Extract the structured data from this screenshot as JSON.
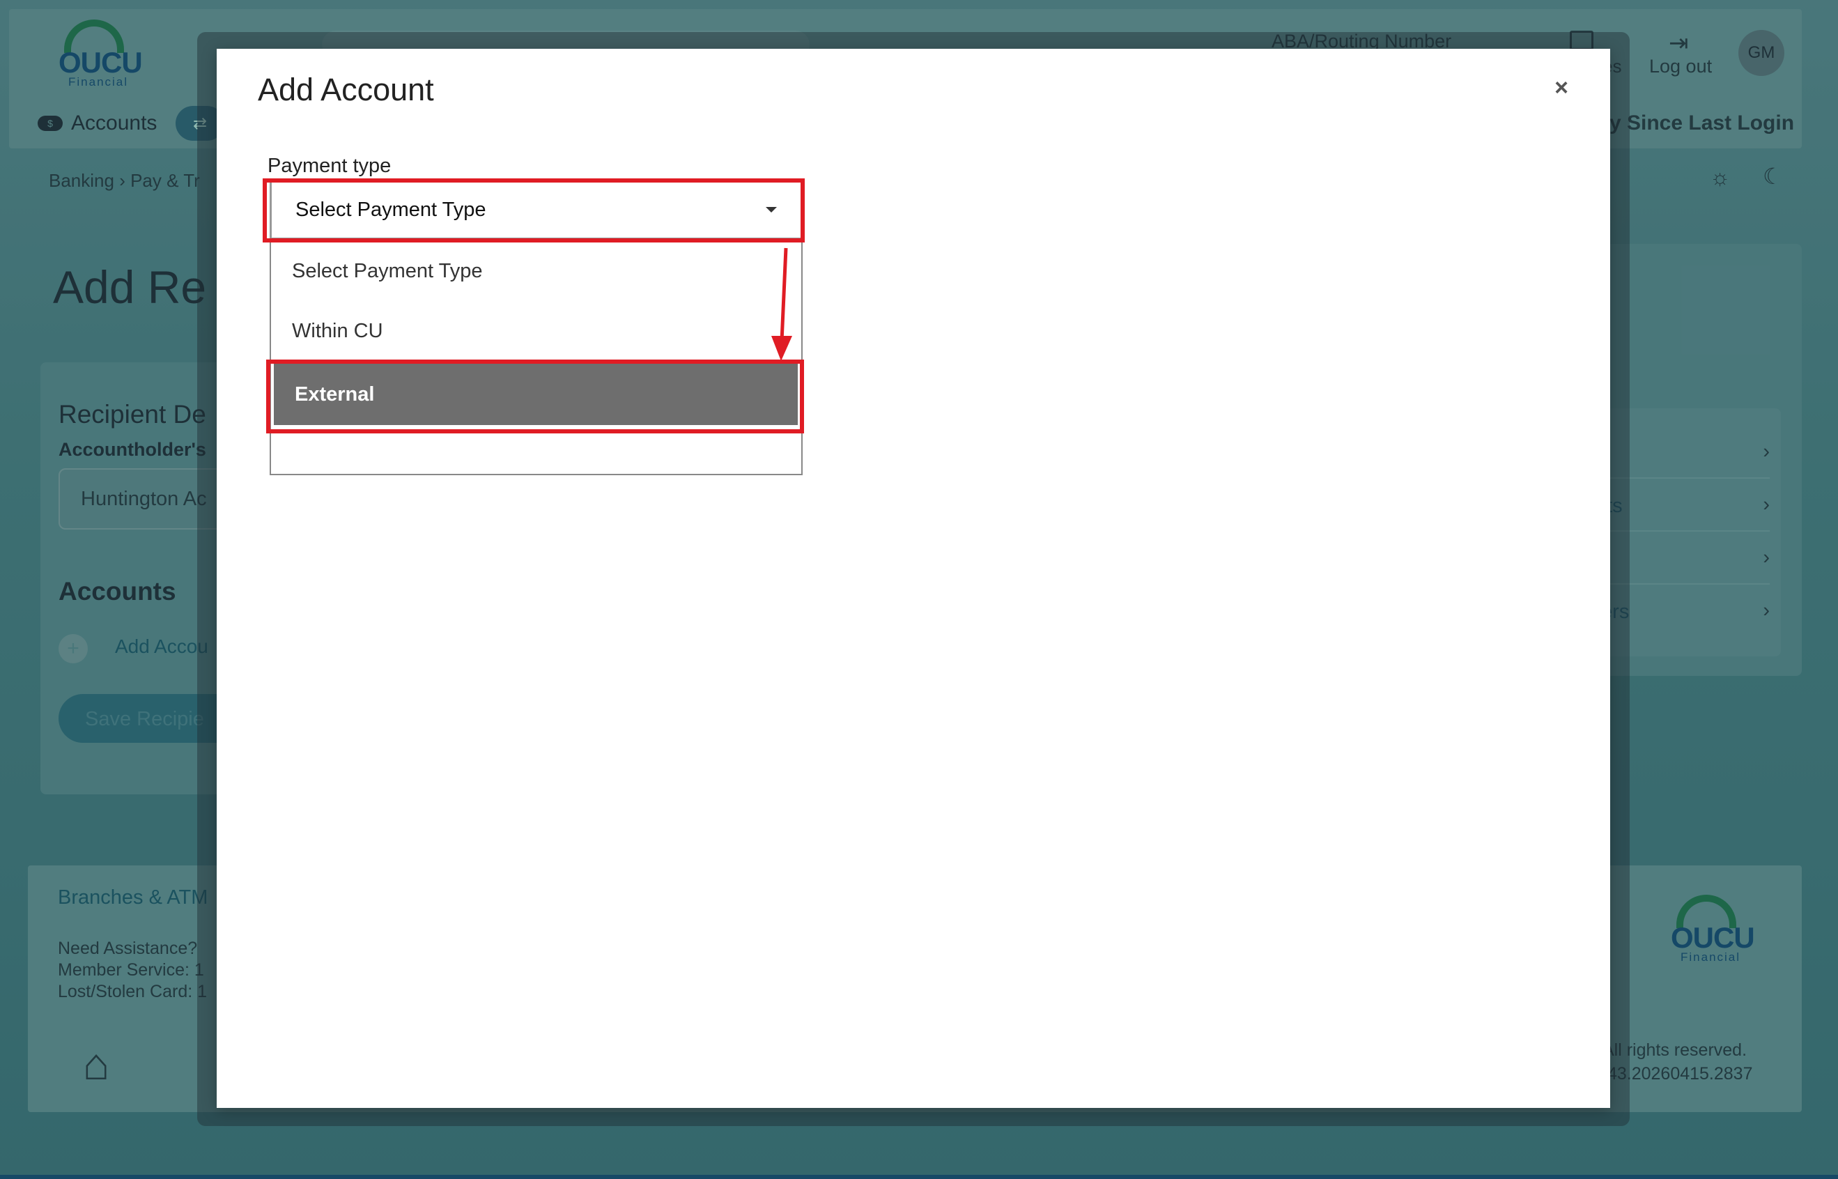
{
  "background": {
    "logo": {
      "word": "OUCU",
      "sub": "Financial"
    },
    "header": {
      "aba_label": "ABA/Routing Number",
      "messages_label_fragment": "es",
      "logout_label": "Log out",
      "avatar_initials": "GM",
      "activity_label_fragment": "ty Since Last Login"
    },
    "nav": {
      "accounts_label": "Accounts"
    },
    "breadcrumb": {
      "root": "Banking",
      "second_fragment": "Pay & Tr"
    },
    "page_title_fragment": "Add Re",
    "recipient": {
      "section_title_fragment": "Recipient De",
      "accountholder_label_fragment": "Accountholder's",
      "accountholder_value_fragment": "Huntington Ac",
      "accounts_heading": "Accounts",
      "add_account_fragment": "Add Accou",
      "save_fragment": "Save Recipie"
    },
    "quick_links": [
      {
        "label": ""
      },
      {
        "label": "nts"
      },
      {
        "label": ""
      },
      {
        "label": "fers"
      }
    ],
    "footer": {
      "branches_fragment": "Branches & ATM",
      "need_assistance": "Need Assistance?",
      "member_service_fragment": "Member Service: 1",
      "lost_card_fragment": "Lost/Stolen Card: 1",
      "rights_fragment": "All rights reserved.",
      "version_fragment": ".43.20260415.2837"
    }
  },
  "modal": {
    "title": "Add Account",
    "close_glyph": "×",
    "payment_type": {
      "label": "Payment type",
      "selected_value": "Select Payment Type",
      "options": [
        {
          "label": "Select Payment Type"
        },
        {
          "label": "Within CU"
        },
        {
          "label": "External"
        }
      ],
      "highlighted_option": "External"
    }
  },
  "colors": {
    "annotation_red": "#e01c24",
    "selected_option_bg": "#6e6e6e",
    "brand_green": "#1d7f4e",
    "brand_blue": "#0f4f7c"
  }
}
